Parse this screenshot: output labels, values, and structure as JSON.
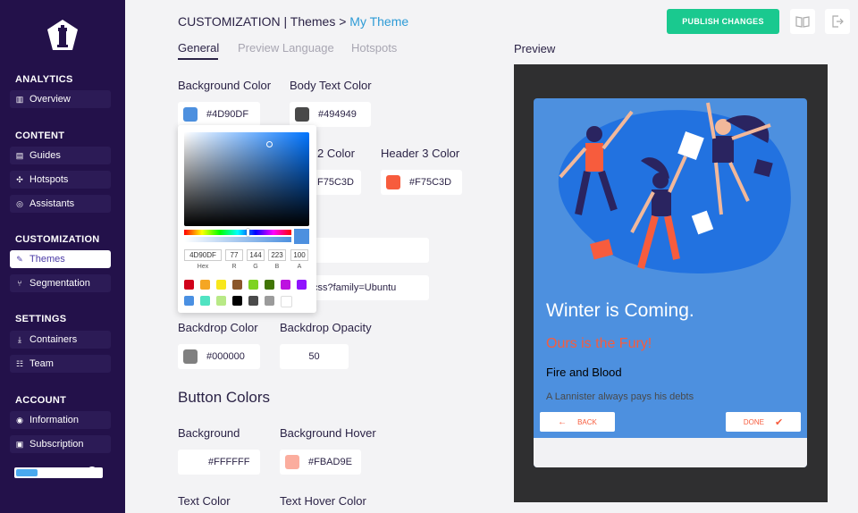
{
  "sidebar": {
    "sections": [
      {
        "title": "ANALYTICS",
        "items": [
          {
            "label": "Overview",
            "icon": "bar-chart-icon"
          }
        ]
      },
      {
        "title": "CONTENT",
        "items": [
          {
            "label": "Guides",
            "icon": "guides-icon"
          },
          {
            "label": "Hotspots",
            "icon": "hotspot-icon"
          },
          {
            "label": "Assistants",
            "icon": "assistant-icon"
          }
        ]
      },
      {
        "title": "CUSTOMIZATION",
        "items": [
          {
            "label": "Themes",
            "icon": "brush-icon"
          },
          {
            "label": "Segmentation",
            "icon": "segment-icon"
          }
        ]
      },
      {
        "title": "SETTINGS",
        "items": [
          {
            "label": "Containers",
            "icon": "download-icon"
          },
          {
            "label": "Team",
            "icon": "team-icon"
          }
        ]
      },
      {
        "title": "ACCOUNT",
        "items": [
          {
            "label": "Information",
            "icon": "user-icon"
          },
          {
            "label": "Subscription",
            "icon": "subscription-icon"
          }
        ]
      }
    ],
    "progress": 0.25
  },
  "breadcrumb": {
    "part1": "CUSTOMIZATION |",
    "part2": "Themes >",
    "current": "My Theme"
  },
  "tabs": [
    "General",
    "Preview Language",
    "Hotspots"
  ],
  "fields": {
    "background_color": {
      "label": "Background Color",
      "value": "#4D90DF",
      "color": "#4D90DF"
    },
    "body_text_color": {
      "label": "Body Text Color",
      "value": "#494949",
      "color": "#494949"
    },
    "header2_color": {
      "label": "2 Color",
      "value": "F75C3D"
    },
    "header3_color": {
      "label": "Header 3 Color",
      "value": "#F75C3D",
      "color": "#F75C3D"
    },
    "font_url_fragment": "css?family=Ubuntu",
    "backdrop_color": {
      "label": "Backdrop Color",
      "value": "#000000",
      "color": "#808080"
    },
    "backdrop_opacity": {
      "label": "Backdrop Opacity",
      "value": "50"
    }
  },
  "button_colors": {
    "title": "Button Colors",
    "background": {
      "label": "Background",
      "value": "#FFFFFF",
      "color": "#FFFFFF"
    },
    "background_hover": {
      "label": "Background Hover",
      "value": "#FBAD9E",
      "color": "#FBAD9E"
    },
    "text_color": {
      "label": "Text Color"
    },
    "text_hover_color": {
      "label": "Text Hover Color"
    }
  },
  "picker": {
    "hex": "4D90DF",
    "r": "77",
    "g": "144",
    "b": "223",
    "a": "100",
    "labels": {
      "hex": "Hex",
      "r": "R",
      "g": "G",
      "b": "B",
      "a": "A"
    },
    "presets": [
      "#D0021B",
      "#F5A623",
      "#F8E71C",
      "#8B572A",
      "#7ED321",
      "#417505",
      "#BD10E0",
      "#9013FE",
      "#4A90E2",
      "#50E3C2",
      "#B8E986",
      "#000000",
      "#4A4A4A",
      "#9B9B9B",
      "#FFFFFF"
    ]
  },
  "header": {
    "publish_label": "PUBLISH CHANGES",
    "preview_label": "Preview"
  },
  "phone": {
    "title": "Winter is Coming.",
    "subtitle": "Ours is the Fury!",
    "header3": "Fire and Blood",
    "body": "A Lannister always pays his debts",
    "back_label": "BACK",
    "done_label": "DONE"
  }
}
